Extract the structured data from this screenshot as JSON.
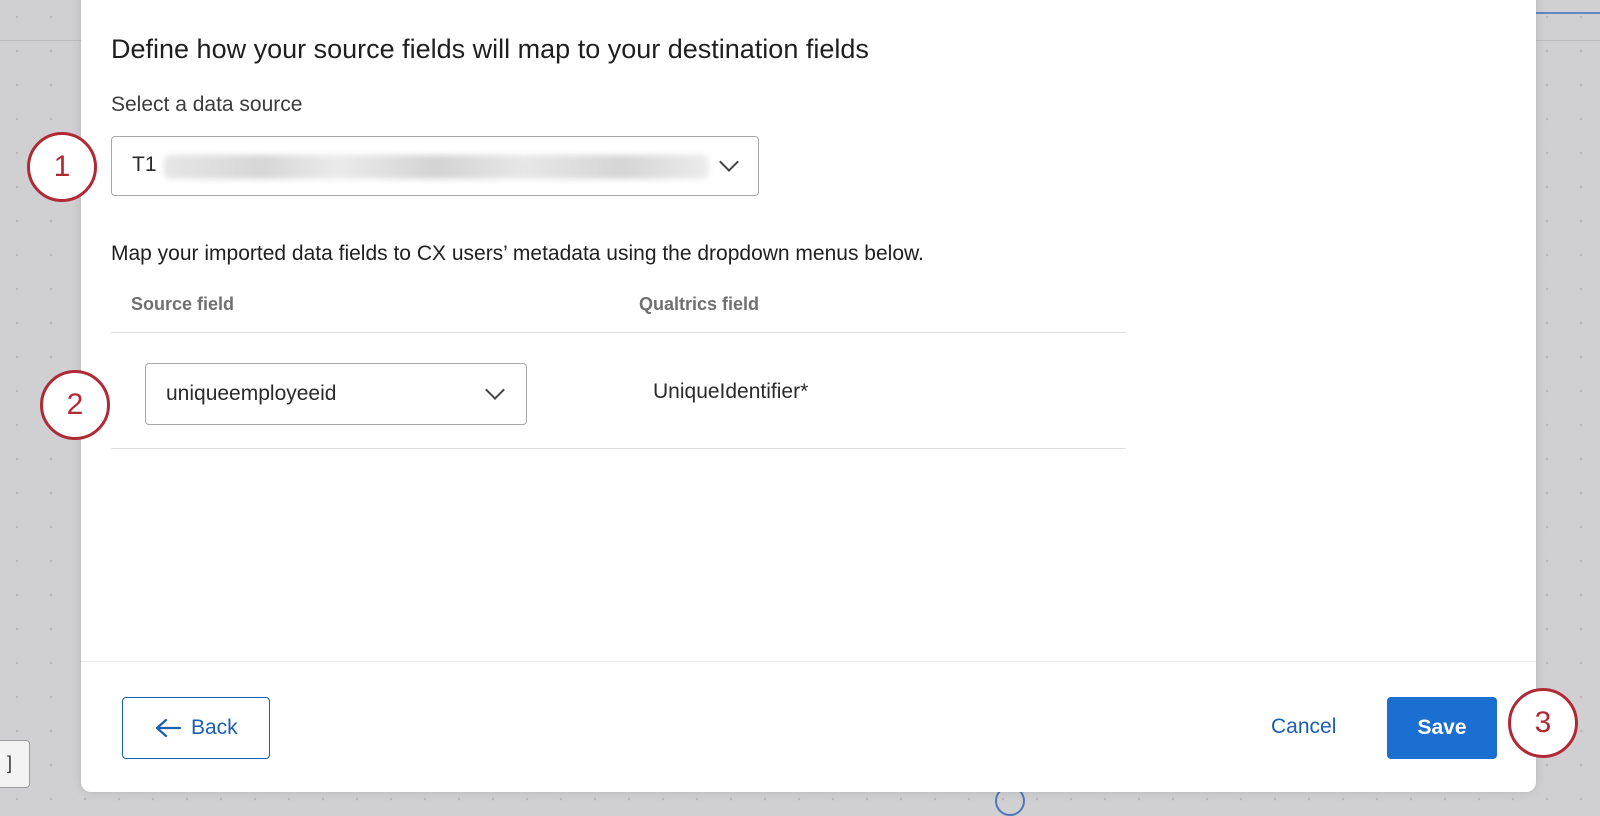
{
  "dialog": {
    "title": "Define how your source fields will map to your destination fields",
    "data_source_label": "Select a data source",
    "data_source_value": "T1",
    "instructions": "Map your imported data fields to CX users’ metadata using the dropdown menus below.",
    "columns": {
      "source": "Source field",
      "qualtrics": "Qualtrics field"
    },
    "rows": [
      {
        "source_value": "uniqueemployeeid",
        "qualtrics_value": "UniqueIdentifier*"
      }
    ],
    "footer": {
      "back_label": "Back",
      "cancel_label": "Cancel",
      "save_label": "Save"
    }
  },
  "callouts": [
    "1",
    "2",
    "3"
  ],
  "colors": {
    "primary": "#1a6fd1",
    "link": "#1a5fb4",
    "callout": "#b02a36"
  },
  "icons": {
    "select_chevron": "chevron-down-icon",
    "back": "arrow-left-icon"
  }
}
